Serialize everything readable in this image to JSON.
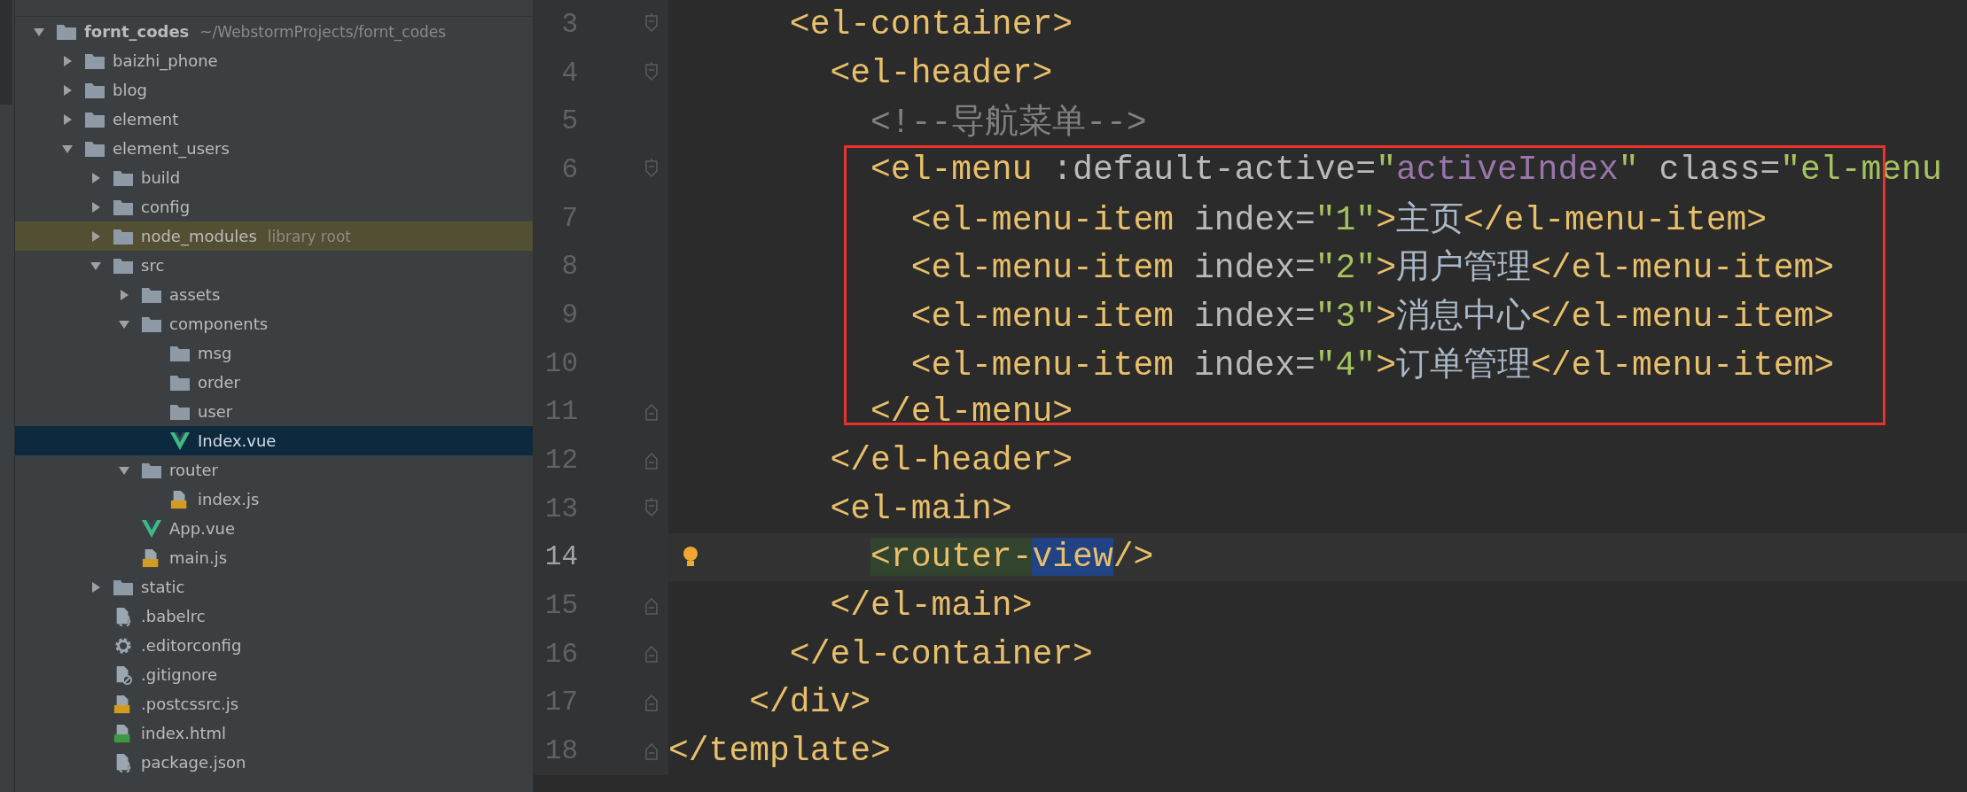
{
  "project_tree": {
    "label": "fornt_codes",
    "hint": "~/WebstormProjects/fornt_codes",
    "kind": "folder",
    "expanded": true,
    "selected": false,
    "highlighted": false,
    "children": [
      {
        "label": "baizhi_phone",
        "kind": "folder",
        "expanded": false,
        "selected": false,
        "highlighted": false
      },
      {
        "label": "blog",
        "kind": "folder",
        "expanded": false,
        "selected": false,
        "highlighted": false
      },
      {
        "label": "element",
        "kind": "folder",
        "expanded": false,
        "selected": false,
        "highlighted": false
      },
      {
        "label": "element_users",
        "kind": "folder",
        "expanded": true,
        "selected": false,
        "highlighted": false,
        "children": [
          {
            "label": "build",
            "kind": "folder",
            "expanded": false,
            "selected": false,
            "highlighted": false
          },
          {
            "label": "config",
            "kind": "folder",
            "expanded": false,
            "selected": false,
            "highlighted": false
          },
          {
            "label": "node_modules",
            "hint": "library root",
            "kind": "folder",
            "expanded": false,
            "selected": false,
            "highlighted": true
          },
          {
            "label": "src",
            "kind": "folder",
            "expanded": true,
            "selected": false,
            "highlighted": false,
            "children": [
              {
                "label": "assets",
                "kind": "folder",
                "expanded": false,
                "selected": false,
                "highlighted": false
              },
              {
                "label": "components",
                "kind": "folder",
                "expanded": true,
                "selected": false,
                "highlighted": false,
                "children": [
                  {
                    "label": "msg",
                    "kind": "folder",
                    "selected": false,
                    "highlighted": false
                  },
                  {
                    "label": "order",
                    "kind": "folder",
                    "selected": false,
                    "highlighted": false
                  },
                  {
                    "label": "user",
                    "kind": "folder",
                    "selected": false,
                    "highlighted": false
                  },
                  {
                    "label": "Index.vue",
                    "kind": "vue",
                    "selected": true,
                    "highlighted": false
                  }
                ]
              },
              {
                "label": "router",
                "kind": "folder",
                "expanded": true,
                "selected": false,
                "highlighted": false,
                "children": [
                  {
                    "label": "index.js",
                    "kind": "js",
                    "selected": false,
                    "highlighted": false
                  }
                ]
              },
              {
                "label": "App.vue",
                "kind": "vue",
                "selected": false,
                "highlighted": false
              },
              {
                "label": "main.js",
                "kind": "js",
                "selected": false,
                "highlighted": false
              }
            ]
          },
          {
            "label": "static",
            "kind": "folder",
            "expanded": false,
            "selected": false,
            "highlighted": false
          },
          {
            "label": ".babelrc",
            "kind": "json",
            "selected": false,
            "highlighted": false
          },
          {
            "label": ".editorconfig",
            "kind": "settings",
            "selected": false,
            "highlighted": false
          },
          {
            "label": ".gitignore",
            "kind": "ignore",
            "selected": false,
            "highlighted": false
          },
          {
            "label": ".postcssrc.js",
            "kind": "js",
            "selected": false,
            "highlighted": false
          },
          {
            "label": "index.html",
            "kind": "html",
            "selected": false,
            "highlighted": false
          },
          {
            "label": "package.json",
            "kind": "json",
            "selected": false,
            "highlighted": false
          }
        ]
      }
    ]
  },
  "lines": [
    {
      "number": "3",
      "kind": "opener",
      "current": false,
      "boxed": false,
      "tokens": [
        {
          "kind": "tag",
          "text": "      <el-container>"
        }
      ]
    },
    {
      "number": "4",
      "kind": "opener",
      "current": false,
      "boxed": false,
      "tokens": [
        {
          "kind": "tag",
          "text": "        <el-header>"
        }
      ]
    },
    {
      "number": "5",
      "kind": "plain",
      "current": false,
      "boxed": false,
      "tokens": [
        {
          "kind": "comment",
          "text": "          <!--导航菜单-->"
        }
      ]
    },
    {
      "number": "6",
      "kind": "opener",
      "current": false,
      "boxed": true,
      "tokens": [
        {
          "kind": "tag",
          "text": "          <el-menu"
        },
        {
          "kind": "attr",
          "text": " :default-active="
        },
        {
          "kind": "string",
          "text": "\""
        },
        {
          "kind": "variable",
          "text": "activeIndex"
        },
        {
          "kind": "string",
          "text": "\""
        },
        {
          "kind": "attr",
          "text": " class="
        },
        {
          "kind": "string",
          "text": "\"el-menu"
        }
      ]
    },
    {
      "number": "7",
      "kind": "plain",
      "current": false,
      "boxed": true,
      "tokens": [
        {
          "kind": "tag",
          "text": "            <el-menu-item"
        },
        {
          "kind": "attr",
          "text": " index="
        },
        {
          "kind": "string",
          "text": "\"1\""
        },
        {
          "kind": "tag",
          "text": ">"
        },
        {
          "kind": "text",
          "text": "主页"
        },
        {
          "kind": "tag",
          "text": "</el-menu-item>"
        }
      ]
    },
    {
      "number": "8",
      "kind": "plain",
      "current": false,
      "boxed": true,
      "tokens": [
        {
          "kind": "tag",
          "text": "            <el-menu-item"
        },
        {
          "kind": "attr",
          "text": " index="
        },
        {
          "kind": "string",
          "text": "\"2\""
        },
        {
          "kind": "tag",
          "text": ">"
        },
        {
          "kind": "text",
          "text": "用户管理"
        },
        {
          "kind": "tag",
          "text": "</el-menu-item>"
        }
      ]
    },
    {
      "number": "9",
      "kind": "plain",
      "current": false,
      "boxed": true,
      "tokens": [
        {
          "kind": "tag",
          "text": "            <el-menu-item"
        },
        {
          "kind": "attr",
          "text": " index="
        },
        {
          "kind": "string",
          "text": "\"3\""
        },
        {
          "kind": "tag",
          "text": ">"
        },
        {
          "kind": "text",
          "text": "消息中心"
        },
        {
          "kind": "tag",
          "text": "</el-menu-item>"
        }
      ]
    },
    {
      "number": "10",
      "kind": "plain",
      "current": false,
      "boxed": true,
      "tokens": [
        {
          "kind": "tag",
          "text": "            <el-menu-item"
        },
        {
          "kind": "attr",
          "text": " index="
        },
        {
          "kind": "string",
          "text": "\"4\""
        },
        {
          "kind": "tag",
          "text": ">"
        },
        {
          "kind": "text",
          "text": "订单管理"
        },
        {
          "kind": "tag",
          "text": "</el-menu-item>"
        }
      ]
    },
    {
      "number": "11",
      "kind": "closer",
      "current": false,
      "boxed": true,
      "tokens": [
        {
          "kind": "tag",
          "text": "          </el-menu>"
        }
      ]
    },
    {
      "number": "12",
      "kind": "closer",
      "current": false,
      "boxed": false,
      "tokens": [
        {
          "kind": "tag",
          "text": "        </el-header>"
        }
      ]
    },
    {
      "number": "13",
      "kind": "opener",
      "current": false,
      "boxed": false,
      "tokens": [
        {
          "kind": "tag",
          "text": "        <el-main>"
        }
      ]
    },
    {
      "number": "14",
      "kind": "plain",
      "current": true,
      "boxed": false,
      "tokens": [
        {
          "kind": "tag",
          "text": "          <router-",
          "brace_match": true,
          "usage": false
        },
        {
          "kind": "tag",
          "text": "view",
          "brace_match": false,
          "usage": true
        },
        {
          "kind": "tag",
          "text": "/>",
          "brace_match": false,
          "usage": false
        }
      ]
    },
    {
      "number": "15",
      "kind": "closer",
      "current": false,
      "boxed": false,
      "tokens": [
        {
          "kind": "tag",
          "text": "        </el-main>"
        }
      ]
    },
    {
      "number": "16",
      "kind": "closer",
      "current": false,
      "boxed": false,
      "tokens": [
        {
          "kind": "tag",
          "text": "      </el-container>"
        }
      ]
    },
    {
      "number": "17",
      "kind": "closer",
      "current": false,
      "boxed": false,
      "tokens": [
        {
          "kind": "tag",
          "text": "    </div>"
        }
      ]
    },
    {
      "number": "18",
      "kind": "closer",
      "current": false,
      "boxed": false,
      "tokens": [
        {
          "kind": "tag",
          "text": "</template>"
        }
      ]
    }
  ]
}
